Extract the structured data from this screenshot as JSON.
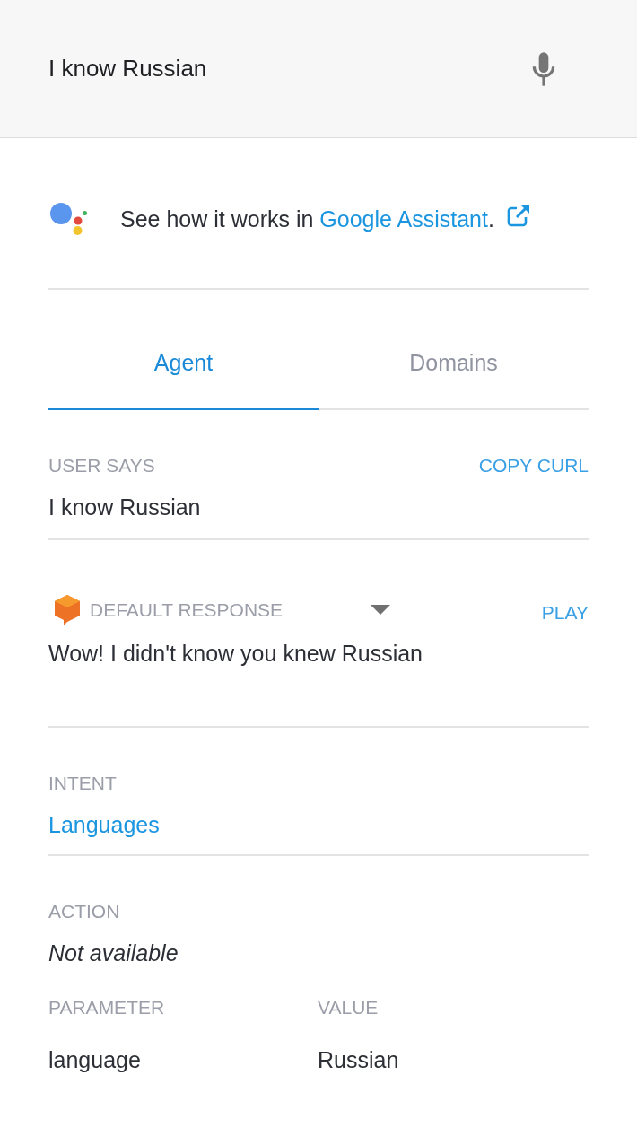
{
  "search": {
    "query": "I know Russian"
  },
  "banner": {
    "text": "See how it works in ",
    "link": "Google Assistant",
    "suffix": "."
  },
  "tabs": [
    {
      "label": "Agent",
      "selected": true
    },
    {
      "label": "Domains",
      "selected": false
    }
  ],
  "user_says": {
    "label": "USER SAYS",
    "action": "COPY CURL",
    "value": "I know Russian"
  },
  "response": {
    "label": "DEFAULT RESPONSE",
    "action": "PLAY",
    "value": "Wow! I didn't know you knew Russian"
  },
  "intent": {
    "label": "INTENT",
    "value": "Languages"
  },
  "action": {
    "label": "ACTION",
    "value": "Not available"
  },
  "parameters": {
    "columns": [
      "PARAMETER",
      "VALUE"
    ],
    "rows": [
      [
        "language",
        "Russian"
      ]
    ]
  }
}
